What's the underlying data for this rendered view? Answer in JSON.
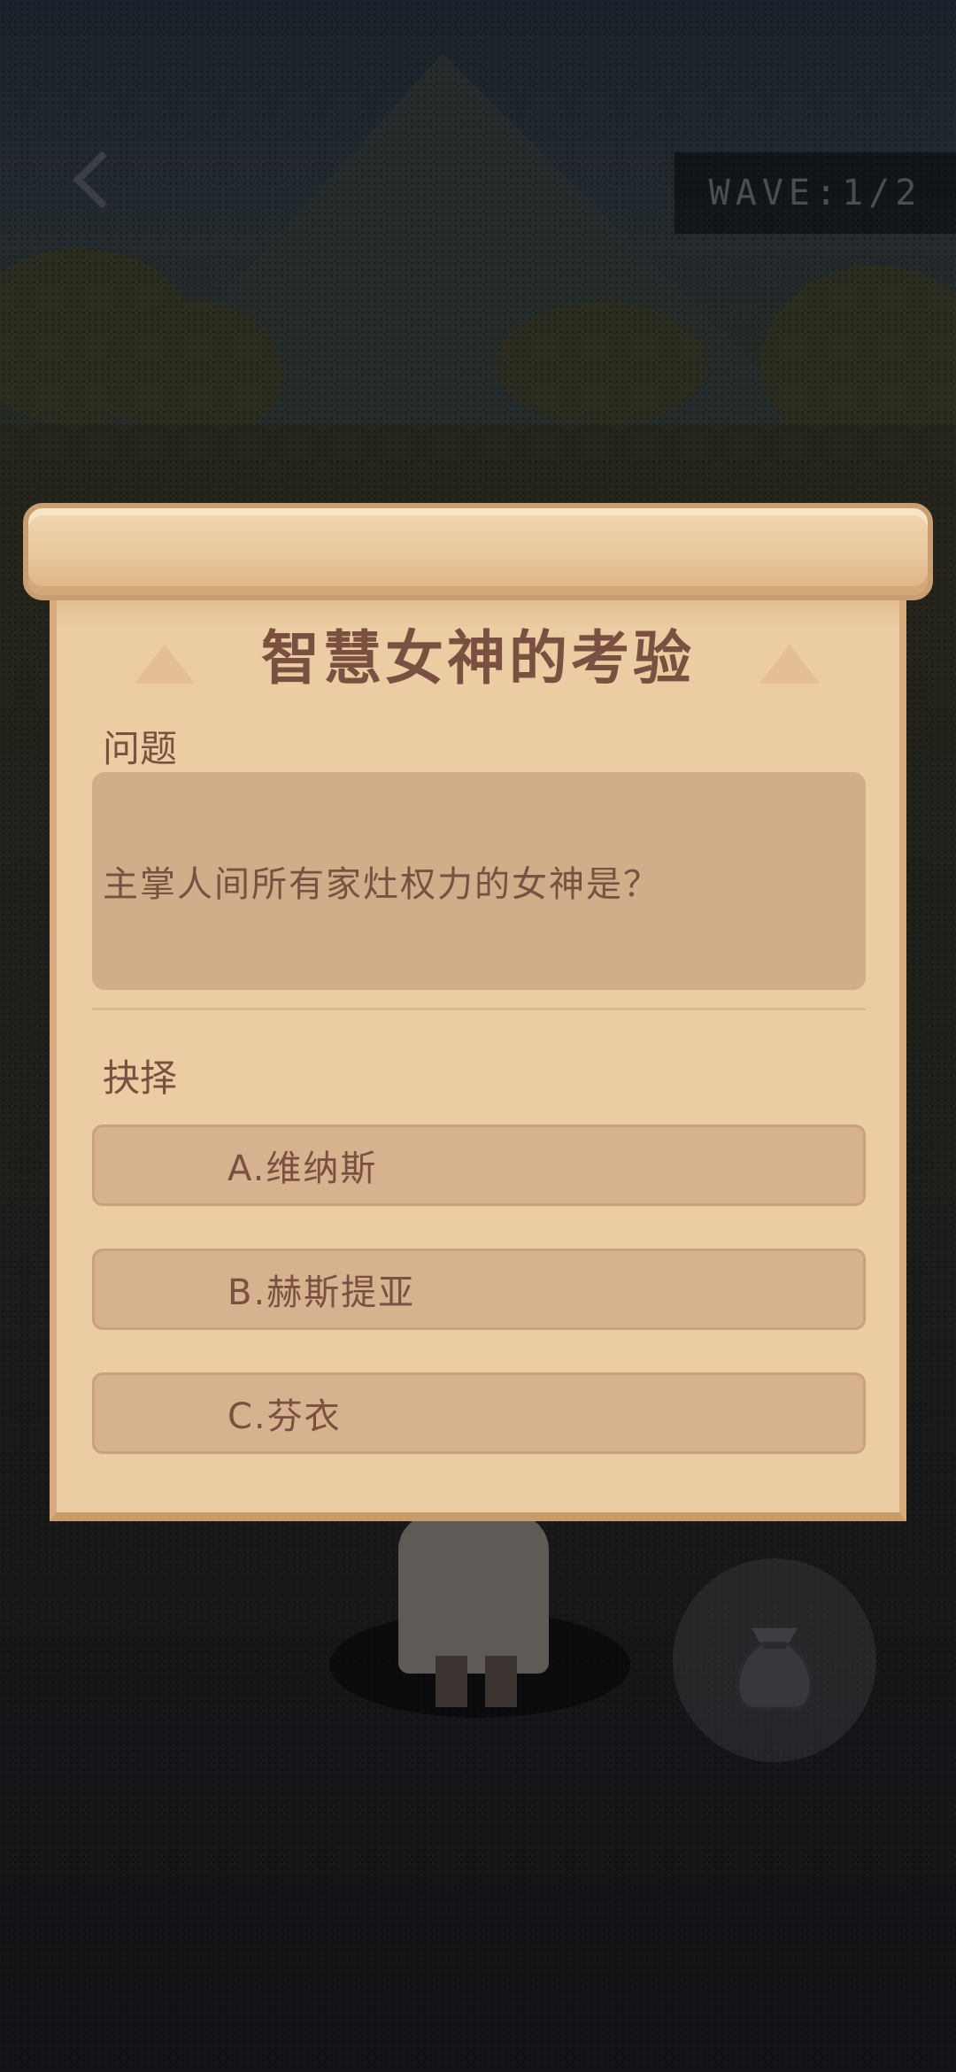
{
  "hud": {
    "wave_label": "WAVE:1/2"
  },
  "dialog": {
    "title": "智慧女神的考验",
    "question_label": "问题",
    "question_text": "主掌人间所有家灶权力的女神是？",
    "choice_label": "抉择",
    "options": [
      {
        "label": "A.维纳斯"
      },
      {
        "label": "B.赫斯提亚"
      },
      {
        "label": "C.芬衣"
      }
    ]
  },
  "colors": {
    "parchment": "#eccca2",
    "text_brown": "#7a5141",
    "panel": "#d1ae8a",
    "backdrop": "#141418"
  },
  "icons": {
    "back": "back-arrow-icon",
    "bag": "bag-icon"
  }
}
